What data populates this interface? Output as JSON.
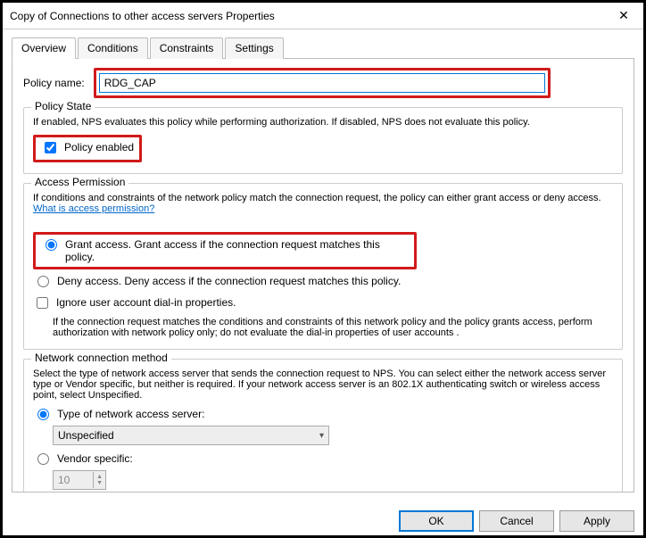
{
  "window": {
    "title": "Copy of Connections to other access servers Properties"
  },
  "tabs": {
    "overview": "Overview",
    "conditions": "Conditions",
    "constraints": "Constraints",
    "settings": "Settings"
  },
  "policy_name": {
    "label": "Policy name:",
    "value": "RDG_CAP"
  },
  "policy_state": {
    "title": "Policy State",
    "desc": "If enabled, NPS evaluates this policy while performing authorization. If disabled, NPS does not evaluate this policy.",
    "enabled_label": "Policy enabled"
  },
  "access_permission": {
    "title": "Access Permission",
    "desc": "If conditions and constraints of the network policy match the connection request, the policy can either grant access or deny access. ",
    "link": "What is access permission?",
    "grant_label": "Grant access. Grant access if the connection request matches this policy.",
    "deny_label": "Deny access. Deny access if the connection request matches this policy.",
    "ignore_label": "Ignore user account dial-in properties.",
    "ignore_desc": "If the connection request matches the conditions and constraints of this network policy and the policy grants access, perform authorization with network policy only; do not evaluate the dial-in properties of user accounts ."
  },
  "network_conn": {
    "title": "Network connection method",
    "desc": "Select the type of network access server that sends the connection request to NPS. You can select either the network access server type or Vendor specific, but neither is required.  If your network access server is an 802.1X authenticating switch or wireless access point, select Unspecified.",
    "type_label": "Type of network access server:",
    "type_value": "Unspecified",
    "vendor_label": "Vendor specific:",
    "vendor_value": "10"
  },
  "buttons": {
    "ok": "OK",
    "cancel": "Cancel",
    "apply": "Apply"
  }
}
